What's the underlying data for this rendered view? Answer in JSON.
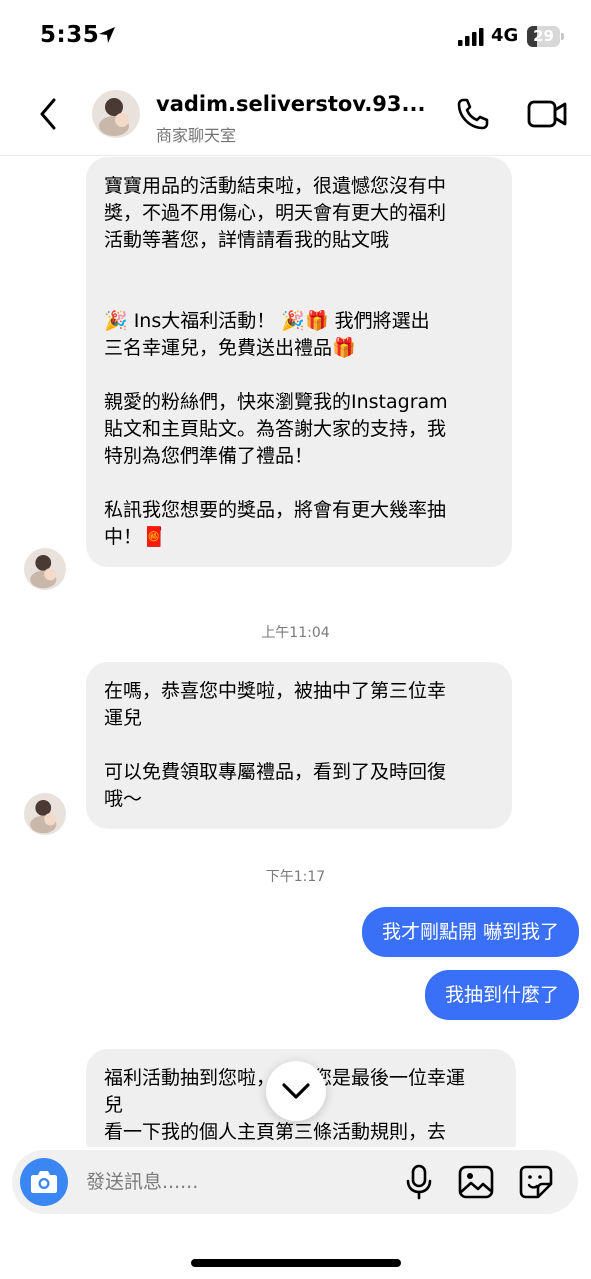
{
  "status_bar": {
    "time": "5:35",
    "network": "4G",
    "battery_level": "29",
    "battery_fraction": 0.29
  },
  "header": {
    "username": "vadim.seliverstov.93...",
    "subtitle": "商家聊天室"
  },
  "messages": [
    {
      "direction": "in",
      "text": "寶寶用品的活動結束啦，很遺憾您沒有中\n獎，不過不用傷心，明天會有更大的福利\n活動等著您，詳情請看我的貼文哦\n\n\n🎉 Ins大福利活動！ 🎉🎁 我們將選出\n三名幸運兒，免費送出禮品🎁\n\n親愛的粉絲們，快來瀏覽我的Instagram\n貼文和主頁貼文。為答謝大家的支持，我\n特別為您們準備了禮品！\n\n私訊我您想要的獎品，將會有更大幾率抽\n中！🧧"
    },
    {
      "direction": "time",
      "text": "上午11:04"
    },
    {
      "direction": "in",
      "text": "在嗎，恭喜您中獎啦，被抽中了第三位幸\n運兒\n\n可以免費領取專屬禮品，看到了及時回復\n哦～"
    },
    {
      "direction": "time",
      "text": "下午1:17"
    },
    {
      "direction": "out",
      "text": "我才剛點開 嚇到我了"
    },
    {
      "direction": "out",
      "text": "我抽到什麼了"
    },
    {
      "direction": "in",
      "text": "福利活動抽到您啦，恭喜您是最後一位幸運\n兒\n看一下我的個人主頁第三條活動規則，去"
    }
  ],
  "composer": {
    "placeholder": "發送訊息......"
  },
  "colors": {
    "outgoing_bubble": "#3a6ff7",
    "incoming_bubble": "#efefef",
    "camera_button": "#3a86f2"
  },
  "icons": {
    "back": "chevron-left-icon",
    "call": "phone-icon",
    "video": "video-camera-icon",
    "scroll": "chevron-down-icon",
    "camera": "camera-icon",
    "mic": "microphone-icon",
    "gallery": "image-icon",
    "sticker": "sticker-icon"
  }
}
